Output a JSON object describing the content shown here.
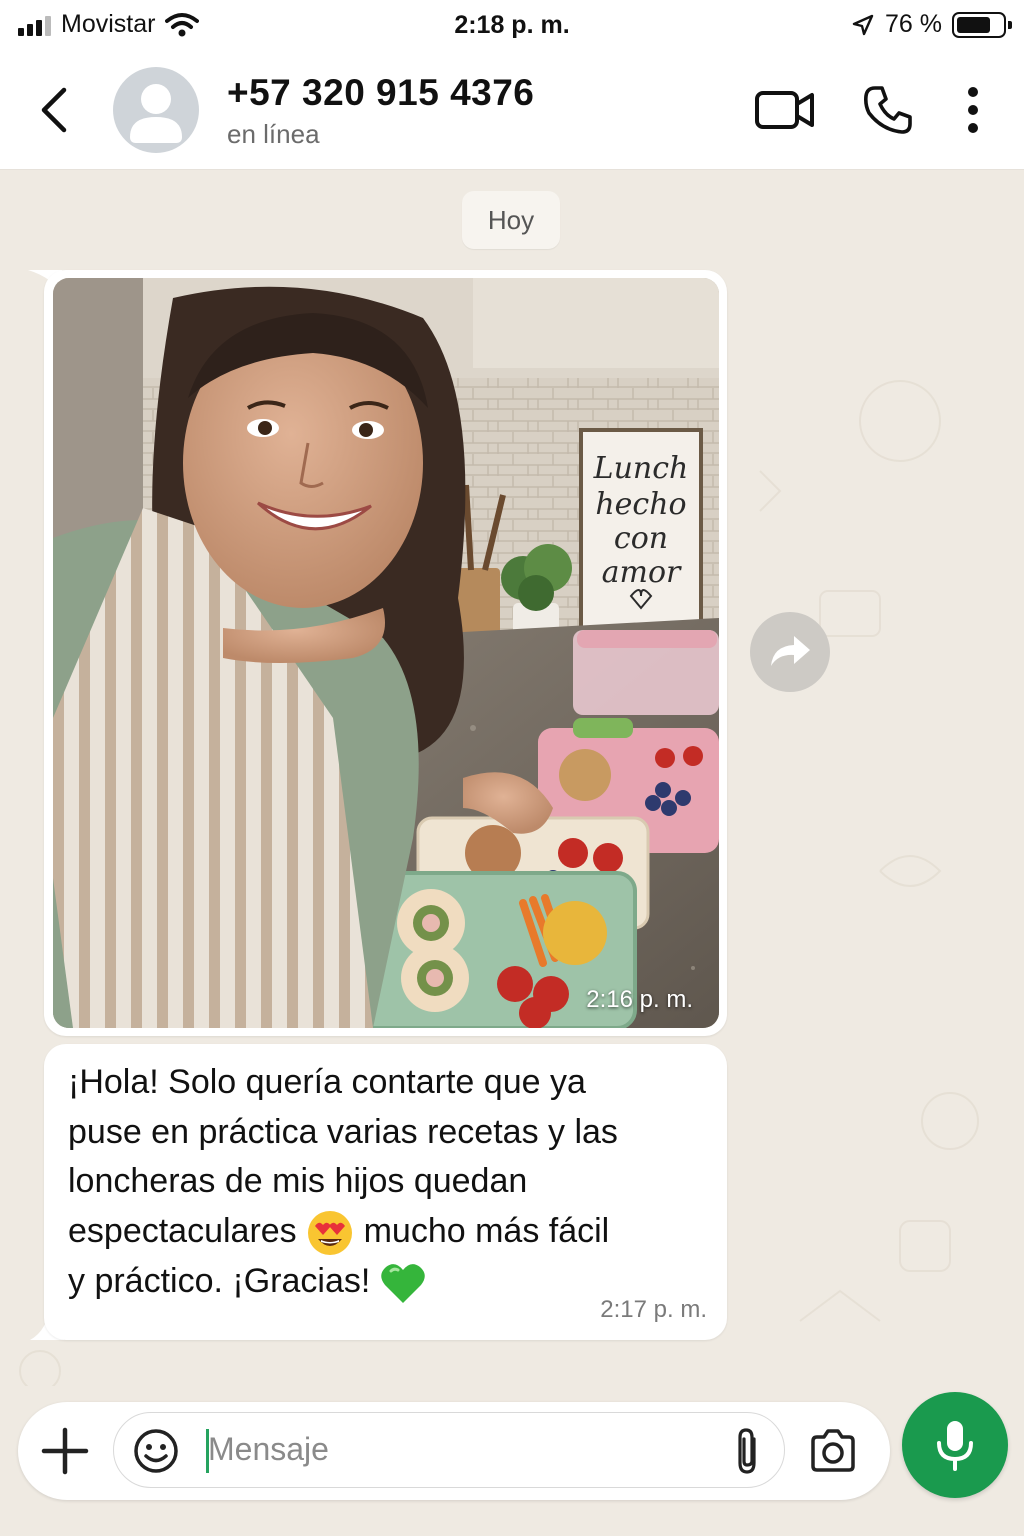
{
  "status_bar": {
    "carrier": "Movistar",
    "time": "2:18 p. m.",
    "battery_percent_label": "76 %",
    "battery_level": 0.76
  },
  "header": {
    "contact_name": "+57 320 915 4376",
    "contact_status": "en línea"
  },
  "chat": {
    "date_chip": "Hoy",
    "messages": [
      {
        "type": "image",
        "time": "2:16 p. m.",
        "sign_text": [
          "Lunch",
          "hecho",
          "con",
          "amor"
        ]
      },
      {
        "type": "text",
        "lines": [
          "¡Hola! Solo quería contarte que ya",
          "puse en práctica varias recetas y las",
          "loncheras de mis hijos quedan",
          "espectaculares",
          "mucho más fácil",
          "y práctico. ¡Gracias!"
        ],
        "emojis": [
          "heart-eyes-emoji",
          "green-heart-emoji"
        ],
        "time": "2:17 p. m."
      }
    ]
  },
  "composer": {
    "placeholder": "Mensaje"
  },
  "icons": [
    "back-chevron-icon",
    "video-call-icon",
    "phone-icon",
    "more-vert-icon",
    "forward-icon",
    "plus-icon",
    "emoji-icon",
    "paperclip-icon",
    "camera-icon",
    "mic-icon",
    "wifi-icon",
    "location-arrow-icon",
    "battery-icon",
    "signal-icon"
  ],
  "colors": {
    "chat_background": "#efeae2",
    "mic_button": "#1a9a4e",
    "bubble": "#ffffff"
  }
}
